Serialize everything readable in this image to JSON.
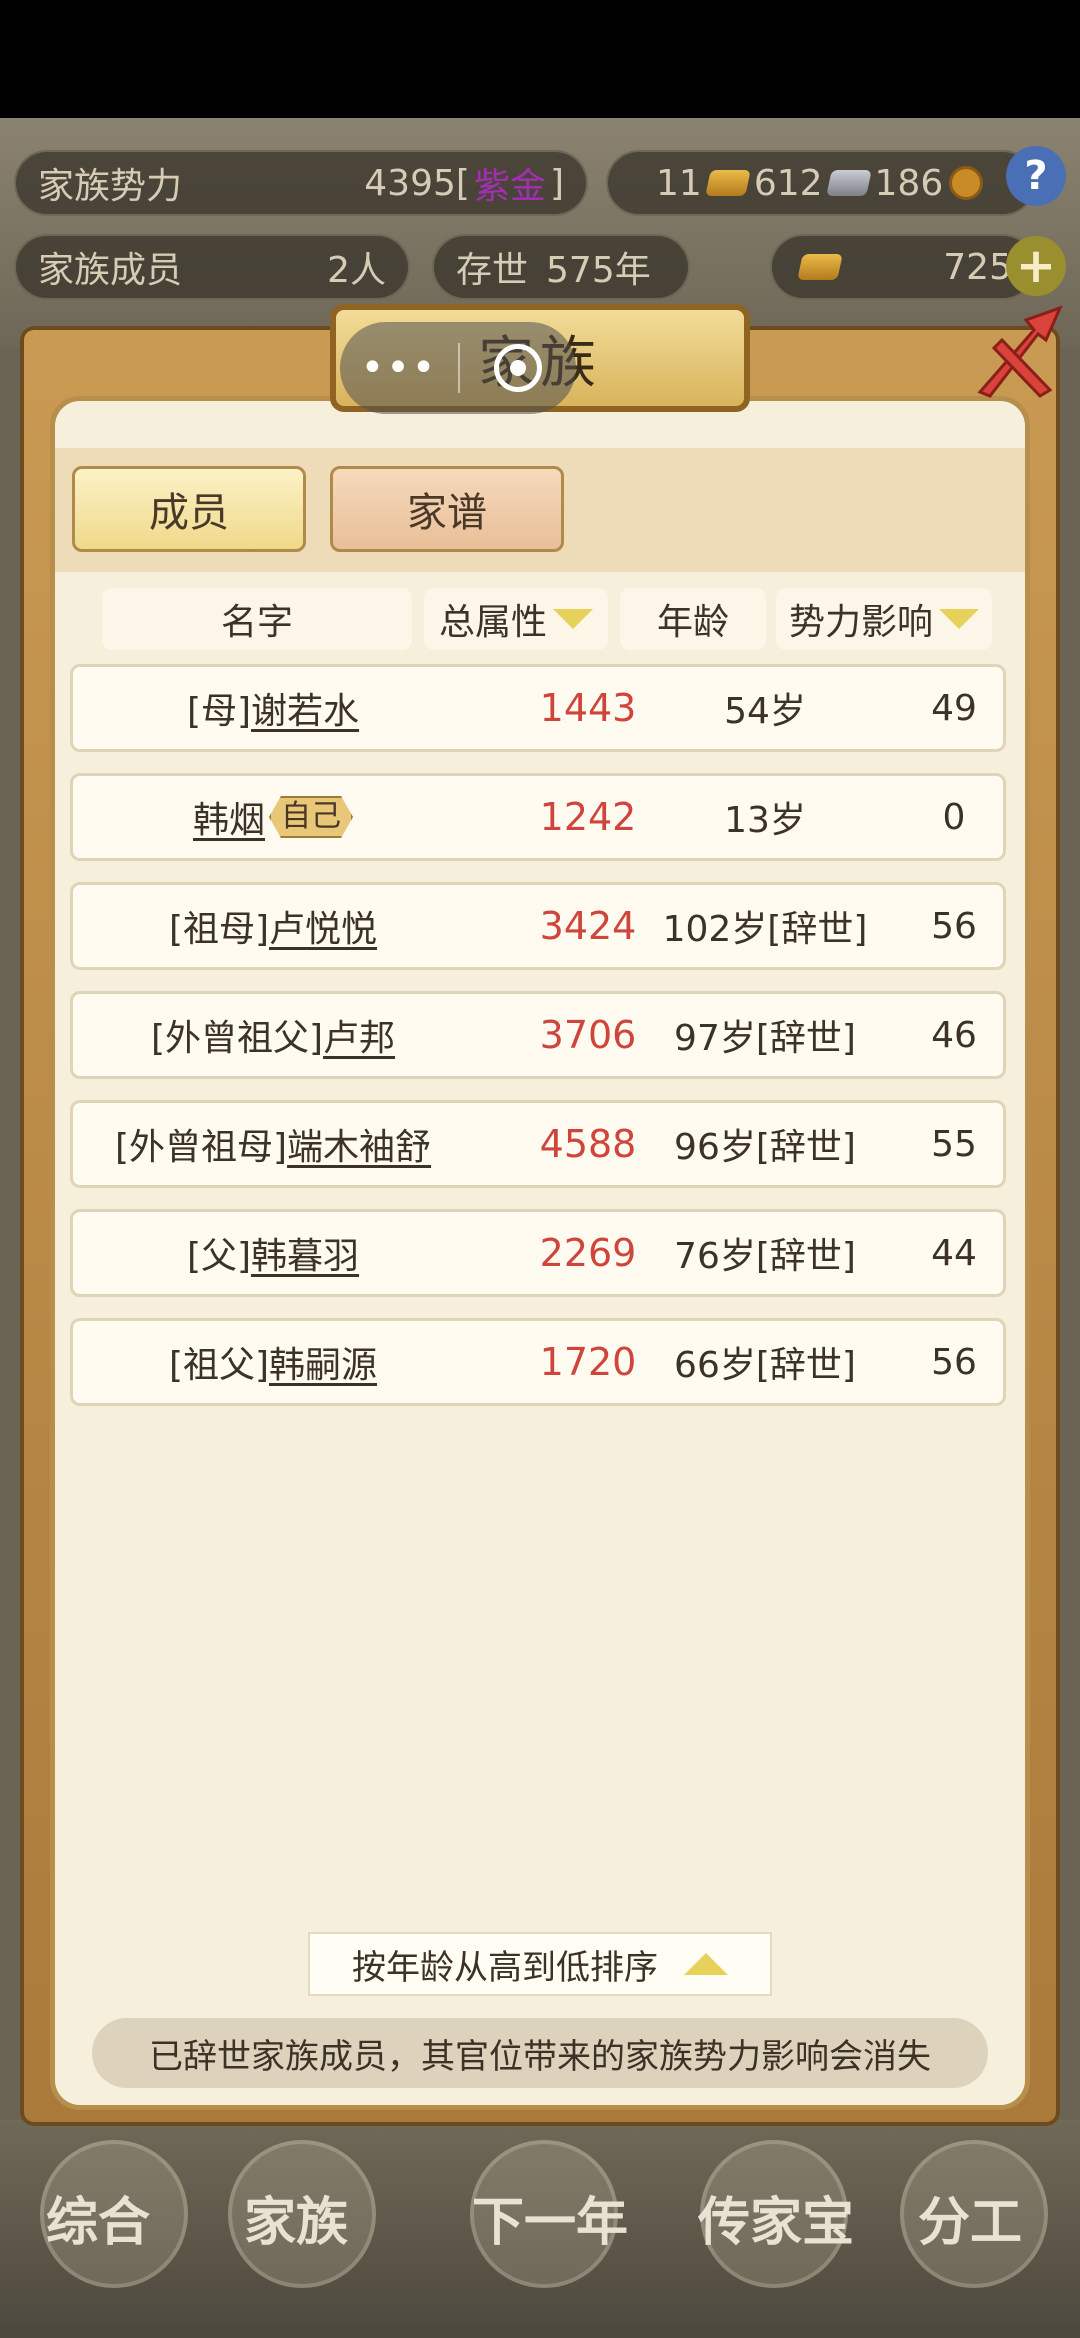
{
  "top_stats": {
    "family_power_label": "家族势力",
    "family_power_value": "4395",
    "family_power_rank": "[",
    "family_power_rank_badge": "紫金",
    "family_power_rank_end": "]",
    "gold_bar": "11",
    "silver_bar": "612",
    "coins": "186",
    "members_label": "家族成员",
    "members_value": "2人",
    "exist_label": "存世",
    "exist_value": "575年",
    "ingot_value": "725"
  },
  "panel": {
    "title": "家族",
    "tabs": [
      "成员",
      "家谱"
    ],
    "columns": {
      "name": "名字",
      "attr": "总属性",
      "age": "年龄",
      "influence": "势力影响"
    },
    "rows": [
      {
        "prefix": "[母]",
        "name": "谢若水",
        "attr": "1443",
        "age": "54岁",
        "influence": "49"
      },
      {
        "prefix": "",
        "name": "韩烟",
        "tag": "自己",
        "attr": "1242",
        "age": "13岁",
        "influence": "0"
      },
      {
        "prefix": "[祖母]",
        "name": "卢悦悦",
        "attr": "3424",
        "age": "102岁[辞世]",
        "influence": "56"
      },
      {
        "prefix": "[外曾祖父]",
        "name": "卢邦",
        "attr": "3706",
        "age": "97岁[辞世]",
        "influence": "46"
      },
      {
        "prefix": "[外曾祖母]",
        "name": "端木袖舒",
        "attr": "4588",
        "age": "96岁[辞世]",
        "influence": "55"
      },
      {
        "prefix": "[父]",
        "name": "韩暮羽",
        "attr": "2269",
        "age": "76岁[辞世]",
        "influence": "44"
      },
      {
        "prefix": "[祖父]",
        "name": "韩嗣源",
        "attr": "1720",
        "age": "66岁[辞世]",
        "influence": "56"
      }
    ],
    "sort_label": "按年龄从高到低排序",
    "notice": "已辞世家族成员，其官位带来的家族势力影响会消失"
  },
  "capsule": {
    "dots": "•••"
  },
  "bottom_nav": [
    "综合",
    "家族",
    "下一年",
    "传家宝",
    "分工"
  ],
  "colors": {
    "attr_red": "#d0453b",
    "panel_bg": "#f6efdb",
    "frame_gold": "#c99a52"
  }
}
